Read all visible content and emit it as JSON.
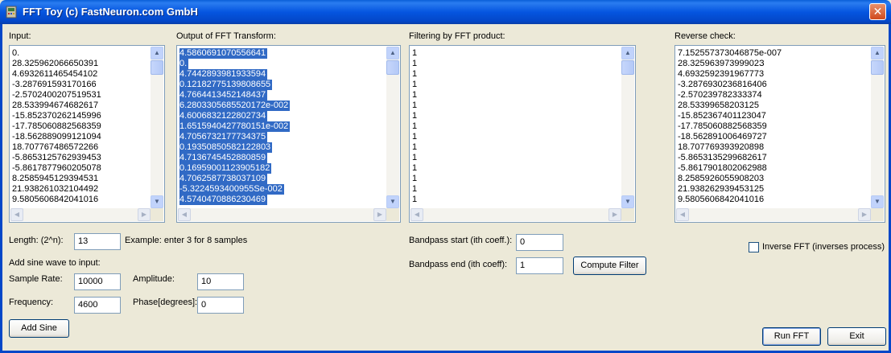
{
  "window": {
    "title": "FFT Toy (c) FastNeuron.com GmbH",
    "close_glyph": "✕",
    "icon": "app-icon"
  },
  "lists": {
    "input": {
      "label": "Input:",
      "items": [
        "0.",
        "28.325962066650391",
        "4.6932611465454102",
        "-3.287691593170166",
        "-2.5702400207519531",
        "28.533994674682617",
        "-15.852370262145996",
        "-17.785060882568359",
        "-18.562889099121094",
        "18.707767486572266",
        "-5.8653125762939453",
        "-5.8617877960205078",
        "8.2585945129394531",
        "21.938261032104492",
        "9.5805606842041016"
      ]
    },
    "output": {
      "label": "Output of FFT Transform:",
      "items": [
        "4.5860691070556641",
        "0.",
        "4.7442893981933594",
        "0.12182775139808655",
        "4.7664413452148437",
        "6.2803305685520172e-002",
        "4.6006832122802734",
        "1.6515940427780151e-002",
        "4.7056732177734375",
        "0.19350850582122803",
        "4.7136745452880859",
        "0.16959001123905182",
        "4.7062587738037109",
        "-5.3224593400955Se-002",
        "4.5740470886230469"
      ]
    },
    "filter": {
      "label": "Filtering by FFT product:",
      "items": [
        "1",
        "1",
        "1",
        "1",
        "1",
        "1",
        "1",
        "1",
        "1",
        "1",
        "1",
        "1",
        "1",
        "1",
        "1"
      ]
    },
    "reverse": {
      "label": "Reverse check:",
      "items": [
        "7.152557373046875e-007",
        "28.32596397399902З",
        "4.6932592391967773",
        "-3.2876930236816406",
        "-2.570239782333374",
        "28.53399658203125",
        "-15.852367401123047",
        "-17.785060882568359",
        "-18.562891006469727",
        "18.707769393920898",
        "-5.8653135299682617",
        "-5.8617901802062988",
        "8.2585926055908203",
        "21.938262939453125",
        "9.5805606842041016"
      ]
    }
  },
  "form": {
    "length_label": "Length: (2^n):",
    "length_value": "13",
    "example_text": "Example: enter 3 for 8 samples",
    "sine_section_label": "Add sine wave to input:",
    "sample_rate_label": "Sample Rate:",
    "sample_rate_value": "10000",
    "amplitude_label": "Amplitude:",
    "amplitude_value": "10",
    "frequency_label": "Frequency:",
    "frequency_value": "4600",
    "phase_label": "Phase[degrees]:",
    "phase_value": "0",
    "add_sine_label": "Add Sine",
    "bandpass_start_label": "Bandpass start (ith coeff.):",
    "bandpass_start_value": "0",
    "bandpass_end_label": "Bandpass end (ith coeff):",
    "bandpass_end_value": "1",
    "compute_filter_label": "Compute Filter",
    "inverse_fft_label": "Inverse FFT (inverses process)",
    "inverse_fft_checked": false,
    "run_fft_label": "Run FFT",
    "exit_label": "Exit"
  },
  "scroll_glyphs": {
    "up": "▲",
    "down": "▼",
    "left": "◀",
    "right": "▶"
  }
}
